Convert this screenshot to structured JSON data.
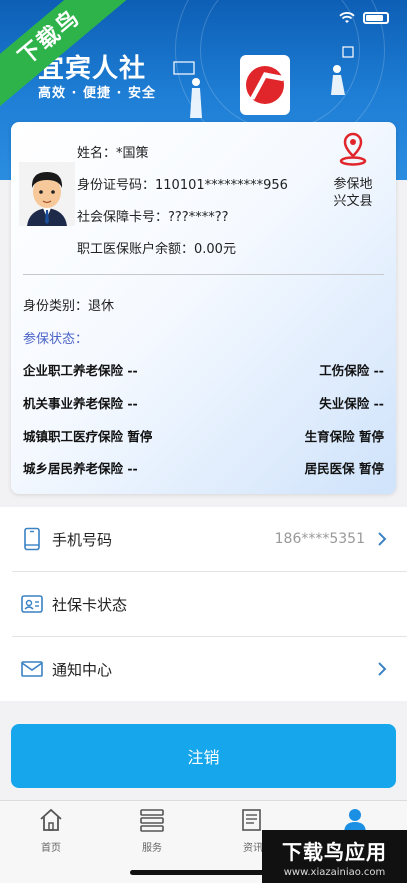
{
  "banner": {
    "title": "宜宾人社",
    "slogan": "高效 · 便捷 · 安全",
    "ribbon": "下载鸟"
  },
  "card": {
    "name_line": "姓名：*国策",
    "id_line": "身份证号码：110101*********956",
    "sscard_line": "社会保障卡号：???****??",
    "balance_line": "职工医保账户余额：0.00元",
    "location_label": "参保地",
    "location_value": "兴文县",
    "type_line": "身份类别：退休",
    "status_title": "参保状态："
  },
  "insurance_rows": [
    {
      "left": "企业职工养老保险 --",
      "right": "工伤保险 --"
    },
    {
      "left": "机关事业养老保险 --",
      "right": "失业保险 --"
    },
    {
      "left": "城镇职工医疗保险 暂停",
      "right": "生育保险 暂停"
    },
    {
      "left": "城乡居民养老保险 --",
      "right": "居民医保 暂停"
    }
  ],
  "list": {
    "phone_label": "手机号码",
    "phone_value": "186****5351",
    "card_status_label": "社保卡状态",
    "notice_label": "通知中心"
  },
  "logout_label": "注销",
  "tabs": [
    {
      "label": "首页"
    },
    {
      "label": "服务"
    },
    {
      "label": "资讯"
    },
    {
      "label": "我的"
    }
  ],
  "watermark": {
    "main": "下载鸟应用",
    "sub": "www.xiazainiao.com"
  },
  "colors": {
    "banner": "#1f7fd6",
    "accent": "#15a6ec",
    "status_title": "#4a63c8",
    "pin": "#e0262b"
  }
}
